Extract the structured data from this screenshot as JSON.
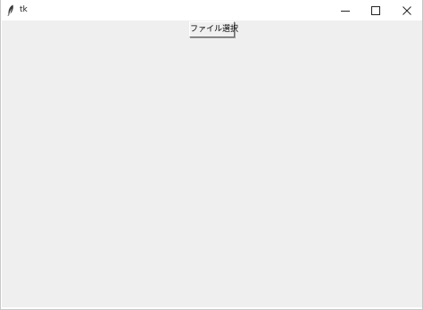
{
  "window": {
    "title": "tk",
    "controls": {
      "minimize_icon": "minimize-icon",
      "maximize_icon": "maximize-icon",
      "close_icon": "close-icon"
    }
  },
  "main": {
    "file_select_label": "ファイル選択"
  },
  "colors": {
    "client_background": "#efefef",
    "titlebar_background": "#ffffff"
  }
}
